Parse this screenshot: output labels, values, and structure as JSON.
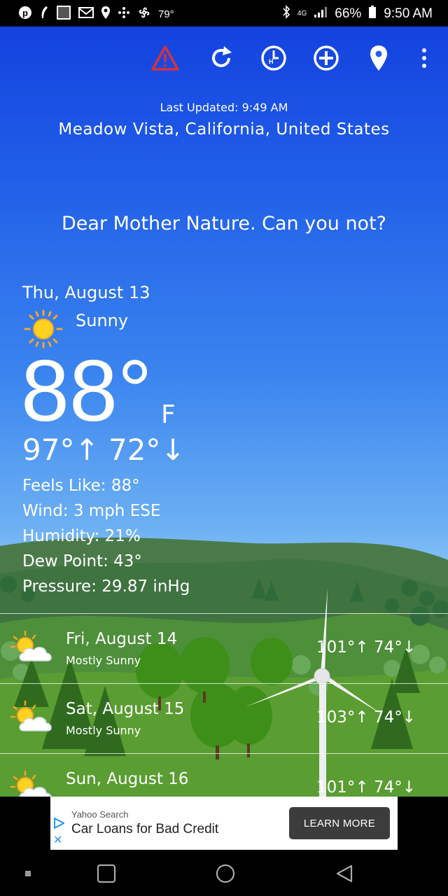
{
  "status_bar": {
    "left_icons": [
      "pinterest-icon",
      "feather-icon",
      "weather-channel-icon",
      "gmail-icon",
      "location-pin-icon",
      "dots-grid-icon",
      "fan-icon"
    ],
    "temperature": "79°",
    "signal_label": "4G",
    "battery_percent": "66%",
    "time": "9:50 AM"
  },
  "toolbar": {
    "icons": [
      "alert-icon",
      "refresh-icon",
      "history-clock-icon",
      "add-location-icon",
      "location-pin-icon",
      "overflow-menu-icon"
    ],
    "alert_color": "#d8323c"
  },
  "header": {
    "last_updated": "Last Updated: 9:49 AM",
    "location": "Meadow Vista, California, United States",
    "quote": "Dear Mother Nature. Can you not?"
  },
  "today": {
    "date": "Thu, August 13",
    "condition": "Sunny",
    "condition_icon": "sun-icon",
    "temperature": "88°",
    "unit": "F",
    "hi_lo": "97°↑ 72°↓",
    "feels_like": "Feels Like: 88°",
    "wind": "Wind: 3 mph ESE",
    "humidity": "Humidity: 21%",
    "dew_point": "Dew Point: 43°",
    "pressure": "Pressure: 29.87 inHg"
  },
  "forecast": [
    {
      "date": "Fri, August 14",
      "condition": "Mostly Sunny",
      "temps": "101°↑ 74°↓",
      "icon": "sun-cloud-icon"
    },
    {
      "date": "Sat, August 15",
      "condition": "Mostly Sunny",
      "temps": "103°↑ 74°↓",
      "icon": "sun-cloud-icon"
    },
    {
      "date": "Sun, August 16",
      "condition": "",
      "temps": "101°↑ 74°↓",
      "icon": "sun-cloud-icon"
    }
  ],
  "ad": {
    "source": "Yahoo Search",
    "title": "Car Loans for Bad Credit",
    "button": "LEARN MORE"
  },
  "nav_bar": {
    "icons": [
      "recents-dot-icon",
      "overview-square-icon",
      "home-circle-icon",
      "back-triangle-icon"
    ]
  }
}
